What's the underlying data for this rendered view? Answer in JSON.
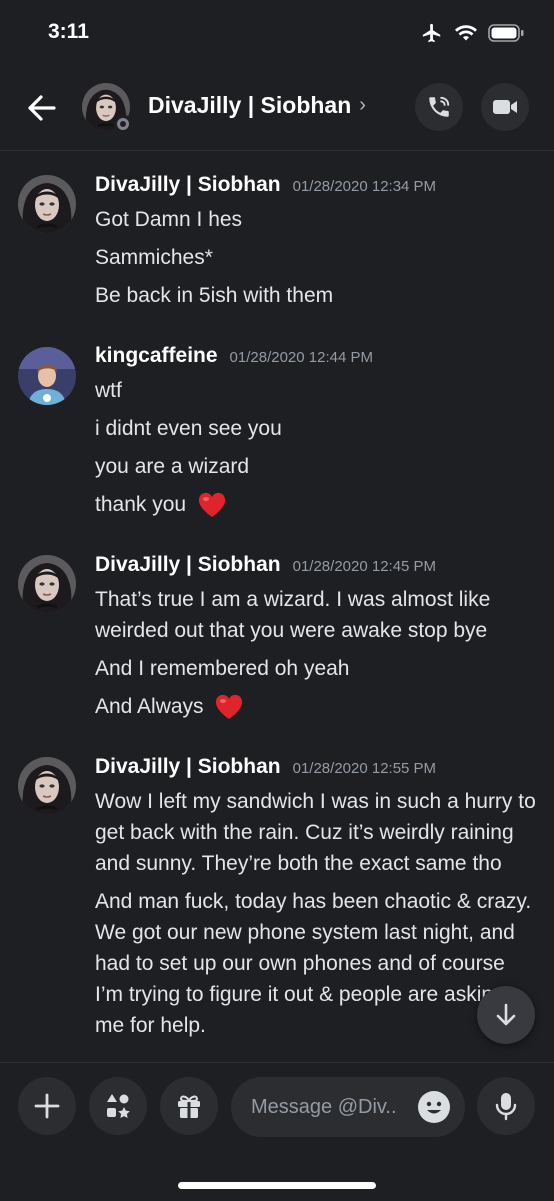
{
  "status_bar": {
    "time": "3:11"
  },
  "header": {
    "title": "DivaJilly | Siobhan",
    "chevron": "›"
  },
  "messages": [
    {
      "author": "DivaJilly | Siobhan",
      "timestamp": "01/28/2020 12:34 PM",
      "lines": [
        "Got Damn I hes",
        "Sammiches*",
        "Be back in 5ish with them"
      ]
    },
    {
      "author": "kingcaffeine",
      "timestamp": "01/28/2020 12:44 PM",
      "lines": [
        "wtf",
        "i didnt even see you",
        "you are a wizard",
        "thank you"
      ]
    },
    {
      "author": "DivaJilly | Siobhan",
      "timestamp": "01/28/2020 12:45 PM",
      "lines": [
        "That’s true I am a wizard. I was almost like weirded out that you were awake stop bye",
        "And I remembered oh yeah",
        "And Always"
      ]
    },
    {
      "author": "DivaJilly | Siobhan",
      "timestamp": "01/28/2020 12:55 PM",
      "lines": [
        "Wow I left my sandwich I was in such a hurry to get back with the rain. Cuz it’s weirdly raining and sunny. They’re both the exact same tho",
        "And man fuck, today has been chaotic & crazy. We got our new phone system last night, and had to set up our own phones and of course I’m trying to figure it out & people are asking me for help."
      ]
    }
  ],
  "composer": {
    "placeholder": "Message @Div.."
  },
  "colors": {
    "background": "#1e1f23",
    "surface": "#2b2d31",
    "heart": "#e0242c"
  },
  "icons": [
    "back-arrow-icon",
    "voice-call-icon",
    "video-call-icon",
    "plus-icon",
    "apps-icon",
    "gift-icon",
    "emoji-icon",
    "microphone-icon",
    "arrow-down-icon",
    "airplane-icon",
    "wifi-icon",
    "battery-icon"
  ]
}
